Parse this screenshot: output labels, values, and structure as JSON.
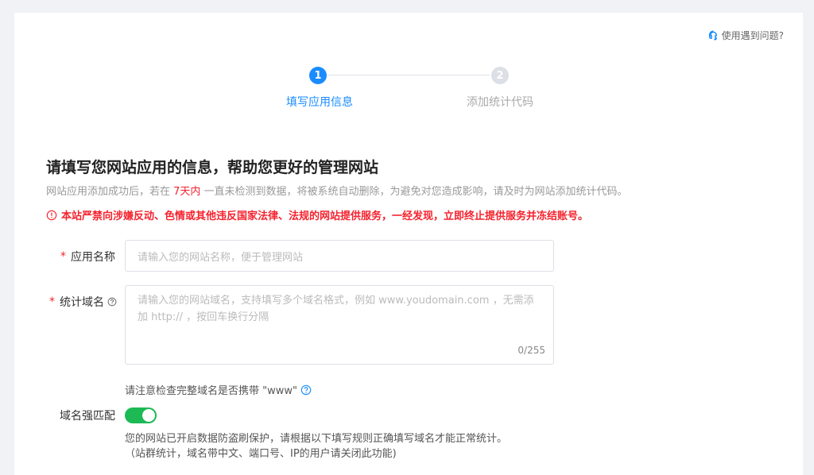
{
  "help": {
    "label": "使用遇到问题?"
  },
  "steps": [
    {
      "number": "1",
      "label": "填写应用信息"
    },
    {
      "number": "2",
      "label": "添加统计代码"
    }
  ],
  "form": {
    "title": "请填写您网站应用的信息，帮助您更好的管理网站",
    "desc_before": "网站应用添加成功后，若在 ",
    "desc_highlight": "7天内",
    "desc_after": " 一直未检测到数据，将被系统自动删除，为避免对您造成影响，请及时为网站添加统计代码。",
    "warning": "本站严禁向涉嫌反动、色情或其他违反国家法律、法规的网站提供服务，一经发现，立即终止提供服务并冻结账号。",
    "app_name": {
      "required_mark": "*",
      "label": "应用名称",
      "placeholder": "请输入您的网站名称，便于管理网站"
    },
    "domain": {
      "required_mark": "*",
      "label": "统计域名",
      "placeholder": "请输入您的网站域名，支持填写多个域名格式，例如 www.youdomain.com ，无需添加 http:// ，按回车换行分隔",
      "counter": "0/255"
    },
    "www_tip": "请注意检查完整域名是否携带 \"www\"",
    "strict_match": {
      "label": "域名强匹配",
      "enabled": true,
      "note_line1": "您的网站已开启数据防盗刷保护，请根据以下填写规则正确填写域名才能正常统计。",
      "note_line2": "（站群统计，域名带中文、端口号、IP的用户请关闭此功能)"
    }
  },
  "colors": {
    "primary": "#1a8cff",
    "danger": "#f5222d",
    "toggle_on": "#1db954"
  }
}
